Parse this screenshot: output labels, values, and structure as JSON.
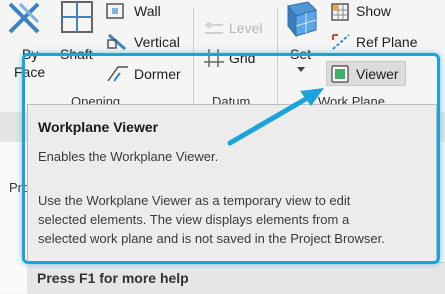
{
  "ribbon": {
    "by_face": {
      "label_line1": "By",
      "label_line2": "Face"
    },
    "shaft": {
      "label": "Shaft"
    },
    "wall": {
      "label": "Wall"
    },
    "vertical": {
      "label": "Vertical"
    },
    "dormer": {
      "label": "Dormer"
    },
    "level": {
      "label": "Level"
    },
    "grid": {
      "label": "Grid"
    },
    "set": {
      "label": "Set"
    },
    "show": {
      "label": "Show"
    },
    "ref_plane": {
      "label": "Ref  Plane"
    },
    "viewer": {
      "label": "Viewer"
    },
    "groups": {
      "opening": "Opening",
      "datum": "Datum",
      "work_plane": "Work Plane"
    }
  },
  "tooltip": {
    "title": "Workplane Viewer",
    "summary": "Enables the Workplane Viewer.",
    "detail_line1": "Use the Workplane Viewer as a temporary view to edit",
    "detail_line2": "selected elements. The view displays elements from a",
    "detail_line3": "selected work plane and is not saved in the Project Browser.",
    "help": "Press F1 for more help"
  },
  "sidebar": {
    "tab_fragment": "Pro"
  },
  "colors": {
    "highlight": "#1aa3dc",
    "arrow": "#1aa3dc"
  }
}
